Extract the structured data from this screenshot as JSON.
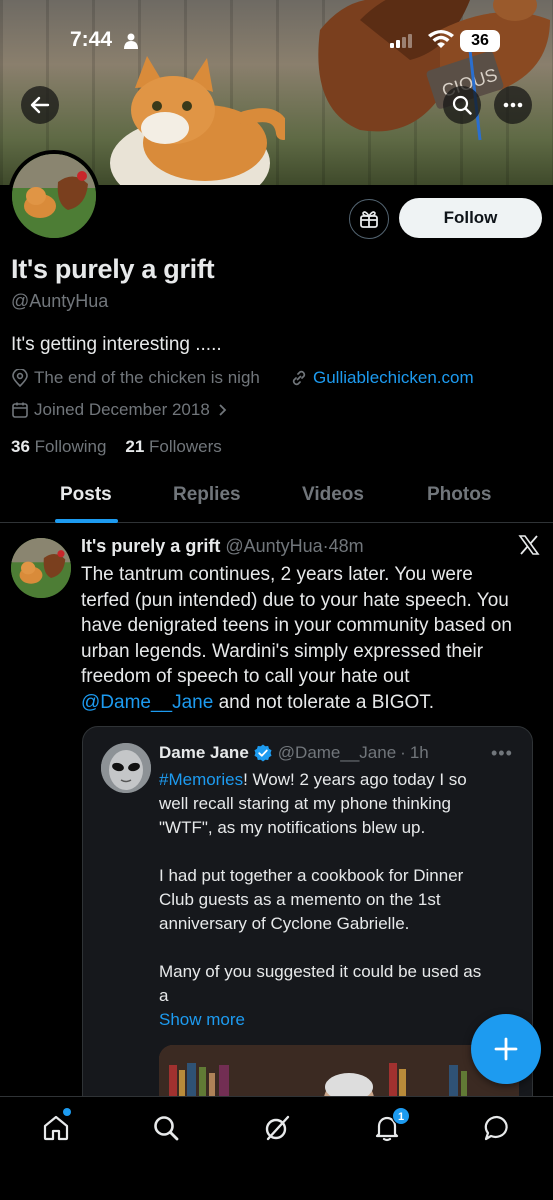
{
  "status_bar": {
    "time": "7:44",
    "battery": "36"
  },
  "profile": {
    "display_name": "It's purely a grift",
    "handle": "@AuntyHua",
    "bio": "It's getting interesting .....",
    "location": "The end of the chicken is nigh",
    "website": "Gulliablechicken.com",
    "joined": "Joined December 2018",
    "following_count": "36",
    "following_label": "Following",
    "followers_count": "21",
    "followers_label": "Followers",
    "follow_label": "Follow"
  },
  "tabs": [
    "Posts",
    "Replies",
    "Videos",
    "Photos"
  ],
  "post": {
    "author_name": "It's purely a grift",
    "author_handle": "@AuntyHua",
    "time": "48m",
    "body_lines": [
      "The tantrum continues, 2 years later. You were",
      "terfed (pun intended) due to your hate speech. You",
      "have denigrated teens in your community based on",
      "urban legends.  Wardini's  simply expressed their",
      "freedom of speech to call your hate out"
    ],
    "mention": "@Dame__Jane",
    "body_end": " and not tolerate a BIGOT."
  },
  "quote": {
    "author_name": "Dame Jane",
    "author_handle": "@Dame__Jane",
    "time": "1h",
    "hashtag": "#Memories",
    "line1_rest": "! Wow! 2 years ago today I so",
    "lines_a": [
      "well recall staring at my phone thinking",
      "\"WTF\", as my notifications blew up."
    ],
    "lines_b": [
      "I had put together a cookbook for Dinner",
      "Club guests as a memento on the 1st",
      "anniversary of Cyclone Gabrielle."
    ],
    "lines_c": [
      "Many of you suggested it could be used as",
      "a"
    ],
    "show_more": "Show more"
  },
  "bottom_nav": {
    "notifications_badge": "1"
  },
  "colors": {
    "accent": "#1d9bf0",
    "background": "#000000",
    "muted": "#71767b"
  }
}
